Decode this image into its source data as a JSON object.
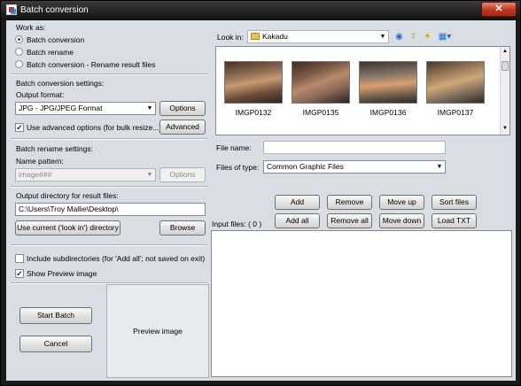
{
  "window": {
    "title": "Batch conversion",
    "close_label": "✕"
  },
  "work_as": {
    "label": "Work as:",
    "options": [
      {
        "label": "Batch conversion",
        "selected": true
      },
      {
        "label": "Batch rename",
        "selected": false
      },
      {
        "label": "Batch conversion - Rename result files",
        "selected": false
      }
    ]
  },
  "conversion": {
    "section_label": "Batch conversion settings:",
    "format_label": "Output format:",
    "format_value": "JPG - JPG/JPEG Format",
    "options_button": "Options",
    "advanced_checkbox_label": "Use advanced options (for bulk resize...)",
    "advanced_checked": true,
    "advanced_button": "Advanced"
  },
  "rename": {
    "section_label": "Batch rename settings:",
    "pattern_label": "Name pattern:",
    "pattern_value": "image###",
    "options_button": "Options"
  },
  "output_dir": {
    "label": "Output directory for result files:",
    "value": "C:\\Users\\Troy Mallie\\Desktop\\",
    "use_current_button": "Use current ('look in') directory",
    "browse_button": "Browse"
  },
  "options": {
    "include_subdirs_label": "Include subdirectories (for 'Add all'; not saved on exit)",
    "include_subdirs_checked": false,
    "show_preview_label": "Show Preview image",
    "show_preview_checked": true
  },
  "actions": {
    "start_button": "Start Batch",
    "cancel_button": "Cancel"
  },
  "preview": {
    "label": "Preview image"
  },
  "browser": {
    "look_in_label": "Look in:",
    "look_in_value": "Kakadu",
    "thumbnails": [
      {
        "name": "IMGP0132"
      },
      {
        "name": "IMGP0135"
      },
      {
        "name": "IMGP0136"
      },
      {
        "name": "IMGP0137"
      }
    ],
    "file_name_label": "File name:",
    "file_name_value": "",
    "files_of_type_label": "Files of type:",
    "files_of_type_value": "Common Graphic Files"
  },
  "list_buttons": {
    "add": "Add",
    "remove": "Remove",
    "move_up": "Move up",
    "sort_files": "Sort files",
    "add_all": "Add all",
    "remove_all": "Remove all",
    "move_down": "Move down",
    "load_txt": "Load TXT"
  },
  "input_files": {
    "label": "Input files: ( 0 )"
  },
  "icons": {
    "folder": "folder-icon",
    "back": "back-icon",
    "up": "up-folder-icon",
    "new_folder": "new-folder-icon",
    "view": "view-menu-icon"
  }
}
